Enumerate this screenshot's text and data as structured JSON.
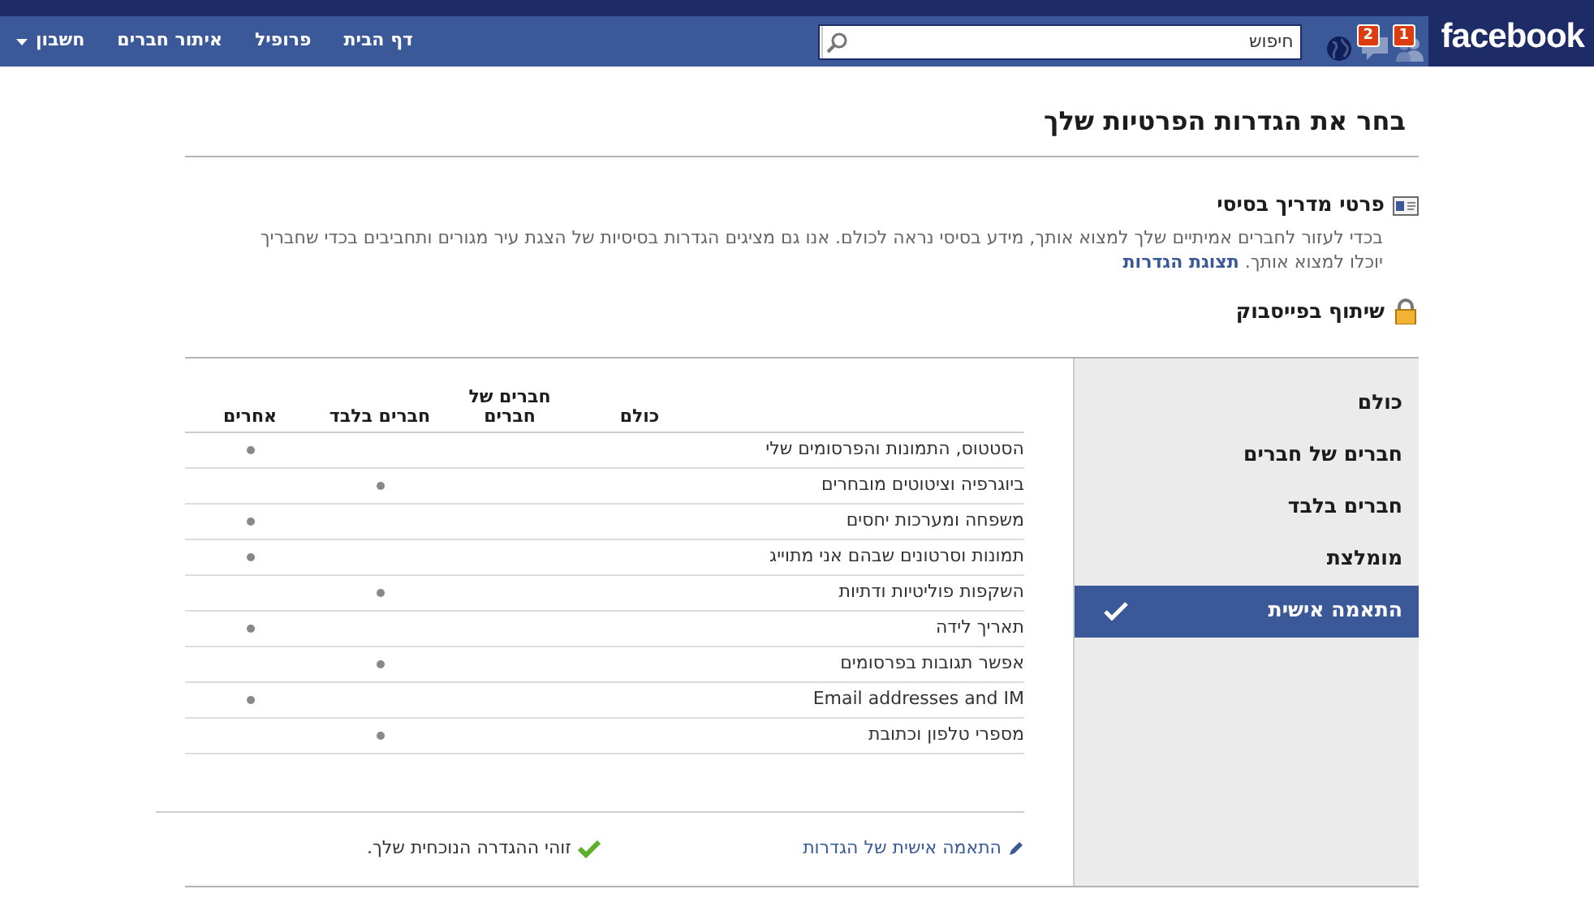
{
  "header": {
    "logo": "facebook",
    "notifications": [
      {
        "kind": "friends",
        "badge": "1"
      },
      {
        "kind": "messages",
        "badge": "2"
      },
      {
        "kind": "globe"
      }
    ],
    "search": {
      "placeholder": "חיפוש"
    },
    "nav": [
      {
        "label": "דף הבית",
        "dropdown": false
      },
      {
        "label": "פרופיל",
        "dropdown": false
      },
      {
        "label": "איתור חברים",
        "dropdown": false
      },
      {
        "label": "חשבון",
        "dropdown": true
      }
    ]
  },
  "page_title": "בחר את הגדרות הפרטיות שלך",
  "basic": {
    "title": "פרטי מדריך בסיסי",
    "text": "בכדי לעזור לחברים אמיתיים שלך למצוא אותך, מידע בסיסי נראה לכולם. אנו גם מציגים הגדרות בסיסיות של הצגת עיר מגורים ותחביבים בכדי שחבריך יוכלו למצוא אותך.",
    "link": "תצוגת הגדרות"
  },
  "sharing": {
    "title": "שיתוף בפייסבוק",
    "presets": [
      {
        "label": "כולם",
        "selected": false
      },
      {
        "label": "חברים של חברים",
        "selected": false
      },
      {
        "label": "חברים בלבד",
        "selected": false
      },
      {
        "label": "מומלצת",
        "selected": false
      },
      {
        "label": "התאמה אישית",
        "selected": true
      }
    ],
    "columns": [
      "כולם",
      "חברים של חברים",
      "חברים בלבד",
      "אחרים"
    ],
    "rows": [
      {
        "label": "הסטטוס, התמונות והפרסומים שלי",
        "dots": [
          false,
          false,
          false,
          true
        ]
      },
      {
        "label": "ביוגרפיה וציטוטים מובחרים",
        "dots": [
          false,
          false,
          true,
          false
        ]
      },
      {
        "label": "משפחה ומערכות יחסים",
        "dots": [
          false,
          false,
          false,
          true
        ]
      },
      {
        "label": "תמונות וסרטונים שבהם אני מתוייג",
        "dots": [
          false,
          false,
          false,
          true
        ]
      },
      {
        "label": "השקפות פוליטיות ודתיות",
        "dots": [
          false,
          false,
          true,
          false
        ]
      },
      {
        "label": "תאריך לידה",
        "dots": [
          false,
          false,
          false,
          true
        ]
      },
      {
        "label": "אפשר תגובות בפרסומים",
        "dots": [
          false,
          false,
          true,
          false
        ]
      },
      {
        "label": "Email addresses and IM",
        "dots": [
          false,
          false,
          false,
          true
        ]
      },
      {
        "label": "מספרי טלפון וכתובת",
        "dots": [
          false,
          false,
          true,
          false
        ]
      }
    ],
    "customize_link": "התאמה אישית של הגדרות",
    "current_note": "זוהי ההגדרה הנוכחית שלך."
  }
}
